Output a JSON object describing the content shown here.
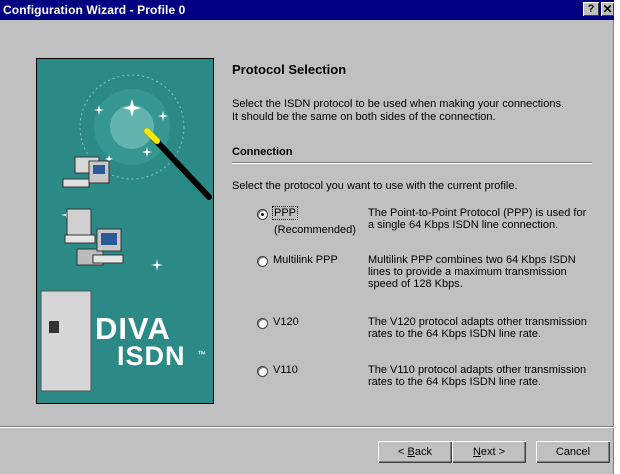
{
  "window": {
    "title": "Configuration Wizard - Profile 0",
    "help_label": "?",
    "close_label": "✕"
  },
  "page": {
    "heading": "Protocol Selection",
    "intro_line1": "Select the ISDN protocol to be used when making your connections.",
    "intro_line2": "It should be the same on both sides of the connection.",
    "section_title": "Connection",
    "select_text": "Select the protocol you want to use with the current profile."
  },
  "art": {
    "brand_line1": "DIVA",
    "brand_line2": "ISDN",
    "brand_mark": "™"
  },
  "options": [
    {
      "label": "PPP",
      "sublabel": "(Recommended)",
      "selected": true,
      "desc_line1": "The Point-to-Point Protocol (PPP) is used for",
      "desc_line2": "a single 64 Kbps ISDN line connection."
    },
    {
      "label": "Multilink PPP",
      "selected": false,
      "desc_line1": "Multilink PPP combines two 64 Kbps ISDN",
      "desc_line2": "lines to provide a maximum transmission",
      "desc_line3": "speed of 128 Kbps."
    },
    {
      "label": "V120",
      "selected": false,
      "desc_line1": "The V120 protocol adapts other transmission",
      "desc_line2": "rates to the 64 Kbps ISDN line rate."
    },
    {
      "label": "V110",
      "selected": false,
      "desc_line1": "The V110 protocol adapts other transmission",
      "desc_line2": "rates to the 64 Kbps ISDN line rate."
    }
  ],
  "buttons": {
    "back_prefix": "< ",
    "back_key": "B",
    "back_rest": "ack",
    "next_key": "N",
    "next_rest": "ext >",
    "cancel": "Cancel"
  },
  "colors": {
    "titlebar": "#000080",
    "dialog_face": "#c0c0c0",
    "art_teal": "#2c8a86"
  }
}
